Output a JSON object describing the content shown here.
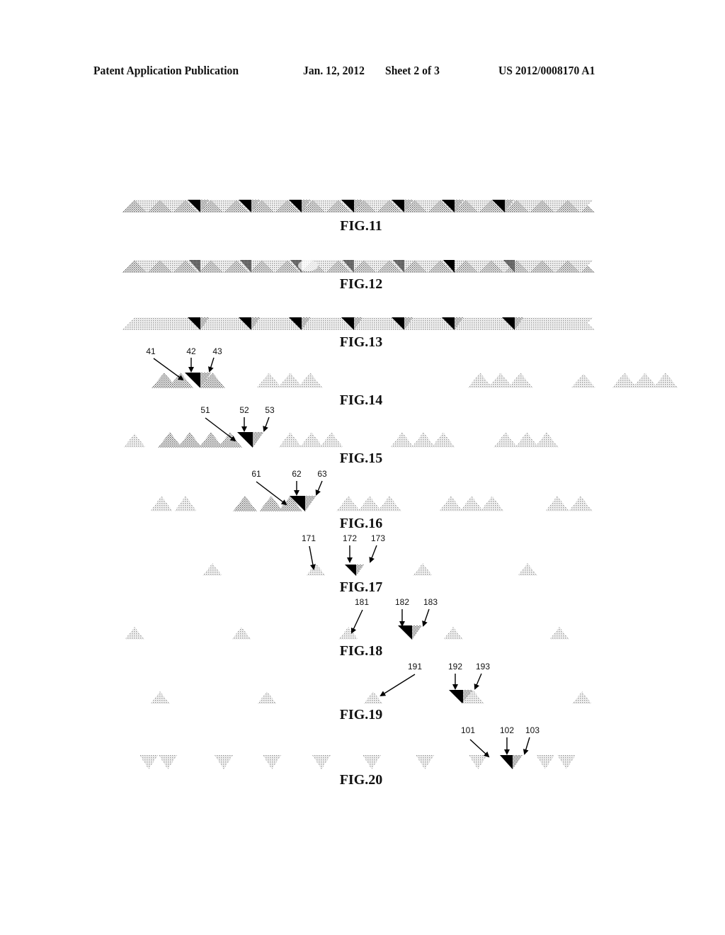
{
  "header": {
    "publication": "Patent Application Publication",
    "date": "Jan. 12, 2012",
    "sheet": "Sheet 2 of 3",
    "number": "US 2012/0008170 A1"
  },
  "colors": {
    "dark_triangle": "#000000",
    "dither_light": "#b8b8b8",
    "dither_mid": "#8a8a8a",
    "text": "#111111"
  },
  "figures": [
    {
      "id": "fig11",
      "caption": "FIG.11",
      "style": "continuous-band",
      "dark_markers": 7,
      "references": []
    },
    {
      "id": "fig12",
      "caption": "FIG.12",
      "style": "continuous-band-varied",
      "dark_markers": 1,
      "references": []
    },
    {
      "id": "fig13",
      "caption": "FIG.13",
      "style": "continuous-band-wavy",
      "dark_markers": 7,
      "references": []
    },
    {
      "id": "fig14",
      "caption": "FIG.14",
      "style": "groups-of-three",
      "references": [
        "41",
        "42",
        "43"
      ]
    },
    {
      "id": "fig15",
      "caption": "FIG.15",
      "style": "groups-of-three",
      "references": [
        "51",
        "52",
        "53"
      ]
    },
    {
      "id": "fig16",
      "caption": "FIG.16",
      "style": "groups-of-three",
      "references": [
        "61",
        "62",
        "63"
      ]
    },
    {
      "id": "fig17",
      "caption": "FIG.17",
      "style": "sparse-single",
      "references": [
        "171",
        "172",
        "173"
      ]
    },
    {
      "id": "fig18",
      "caption": "FIG.18",
      "style": "sparse-single",
      "references": [
        "181",
        "182",
        "183"
      ]
    },
    {
      "id": "fig19",
      "caption": "FIG.19",
      "style": "sparse-single",
      "references": [
        "191",
        "192",
        "193"
      ]
    },
    {
      "id": "fig20",
      "caption": "FIG.20",
      "style": "inverted-pairs",
      "references": [
        "101",
        "102",
        "103"
      ]
    }
  ]
}
